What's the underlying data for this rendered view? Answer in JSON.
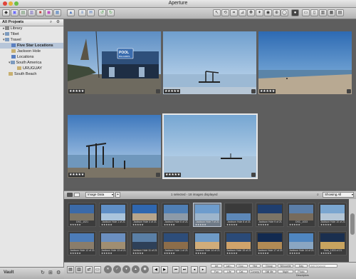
{
  "window": {
    "title": "Aperture"
  },
  "sidebar": {
    "header": "All Projects",
    "items": [
      {
        "label": "Library"
      },
      {
        "label": "Tibet"
      },
      {
        "label": "Travel"
      },
      {
        "label": "Five Star Locations"
      },
      {
        "label": "Jackson Hole"
      },
      {
        "label": "Locations"
      },
      {
        "label": "South America"
      },
      {
        "label": "URUGUAY"
      },
      {
        "label": "South Beach"
      }
    ],
    "vault_label": "Vault"
  },
  "browser": {
    "metadata_view": "Image Data",
    "status": "1 selected - 18 images displayed",
    "filter": "Showing All",
    "thumbnails": [
      {
        "caption": "DSC_1021",
        "stars": "★★★★★"
      },
      {
        "caption": "Jackson Hole 1 of 21",
        "stars": "★★★★★"
      },
      {
        "caption": "Jackson Hole 4 of 21",
        "stars": "★★★★★"
      },
      {
        "caption": "Jackson Hole 6 of 21",
        "stars": "★★★★★"
      },
      {
        "caption": "Jackson Hole 7 of 21",
        "stars": "★★★★★"
      },
      {
        "caption": "Jackson Hole 8 of 21",
        "stars": "★★★★★"
      },
      {
        "caption": "Jackson Hole 9 of 21",
        "stars": "★★★★★"
      },
      {
        "caption": "DSC_1033",
        "stars": "★★★★★"
      },
      {
        "caption": "Jackson Hole 10 of 21",
        "stars": "★★★★★"
      },
      {
        "caption": "Jackson Hole 12 of 21",
        "stars": "★★★★★"
      },
      {
        "caption": "Jackson Hole 13 of 21",
        "stars": "★★★★★"
      },
      {
        "caption": "Jackson Hole 11 of 21",
        "stars": "★★★★★"
      },
      {
        "caption": "Jackson Hole 1 of 21",
        "stars": "★★★★★"
      },
      {
        "caption": "Jackson Hole 14 of 21",
        "stars": "★★★★★"
      },
      {
        "caption": "Jackson Hole 15 of 21",
        "stars": "★★★★★"
      },
      {
        "caption": "Jackson Hole 17 of 21",
        "stars": "★★★★★"
      },
      {
        "caption": "Jackson Hole 14 of 21",
        "stars": "★★★★★"
      },
      {
        "caption": "Sofu_1003 of 21",
        "stars": "★★★★★"
      }
    ]
  },
  "viewer": {
    "photos": [
      {
        "stars": "★★★★★"
      },
      {
        "stars": "★★★★★"
      },
      {
        "stars": "★★★★★"
      },
      {
        "stars": "★★★★★"
      },
      {
        "stars": "★★★★★"
      }
    ]
  },
  "keywords": {
    "row1": [
      "Art",
      "Lan...",
      "Doc...",
      "Hist",
      "Group",
      "Silhouette",
      "Day",
      "Add Keyword"
    ],
    "row2": [
      "Fun",
      "Life",
      "Cat...",
      "Concep",
      "Still life",
      "Night",
      "Photo Descriptors"
    ]
  },
  "colors": {
    "selection": "#b7c6d9",
    "viewer_bg": "#5e5e5e",
    "sidebar_bg": "#e6e6e6"
  }
}
